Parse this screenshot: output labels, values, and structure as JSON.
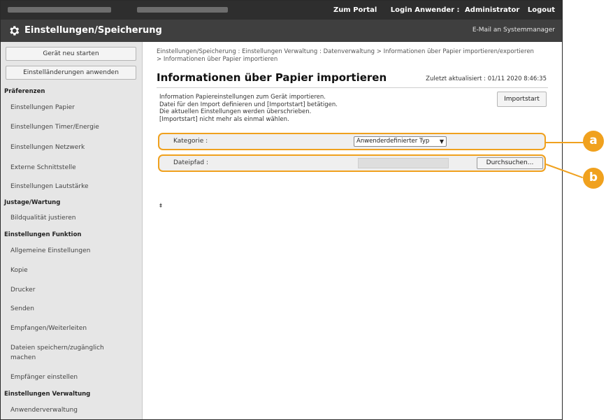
{
  "topbar": {
    "portal_link": "Zum Portal",
    "login_label": "Login Anwender :",
    "user": "Administrator",
    "logout": "Logout"
  },
  "titlebar": {
    "title": "Einstellungen/Speicherung",
    "mail_link": "E-Mail an Systemmanager"
  },
  "sidebar": {
    "buttons": [
      "Gerät neu starten",
      "Einstelländerungen anwenden"
    ],
    "sections": [
      {
        "title": "Präferenzen",
        "items": [
          "Einstellungen Papier",
          "Einstellungen Timer/Energie",
          "Einstellungen Netzwerk",
          "Externe Schnittstelle",
          "Einstellungen Lautstärke"
        ]
      },
      {
        "title": "Justage/Wartung",
        "items": [
          "Bildqualität justieren"
        ]
      },
      {
        "title": "Einstellungen Funktion",
        "items": [
          "Allgemeine Einstellungen",
          "Kopie",
          "Drucker",
          "Senden",
          "Empfangen/Weiterleiten",
          "Dateien speichern/zugänglich machen",
          "Empfänger einstellen"
        ]
      },
      {
        "title": "Einstellungen Verwaltung",
        "items": [
          "Anwenderverwaltung"
        ]
      }
    ]
  },
  "content": {
    "breadcrumb": "Einstellungen/Speicherung : Einstellungen Verwaltung : Datenverwaltung > Informationen über Papier importieren/exportieren > Informationen über Papier importieren",
    "page_title": "Informationen über Papier importieren",
    "last_updated": "Zuletzt aktualisiert : 01/11 2020 8:46:35",
    "import_button": "Importstart",
    "description": [
      "Information Papiereinstellungen zum Gerät importieren.",
      "Datei für den Import definieren und [Importstart] betätigen.",
      "Die aktuellen Einstellungen werden überschrieben.",
      "[Importstart] nicht mehr als einmal wählen."
    ],
    "category_label": "Kategorie :",
    "category_value": "Anwenderdefinierter Typ",
    "filepath_label": "Dateipfad :",
    "filepath_value": "",
    "browse_button": "Durchsuchen...",
    "to_top": "⯒"
  },
  "callouts": {
    "a": "a",
    "b": "b",
    "color": "#f0a11e"
  },
  "icons": {
    "gear": "gear-icon",
    "chevron": "chevron-down-icon",
    "to_top": "arrow-to-top-icon"
  }
}
